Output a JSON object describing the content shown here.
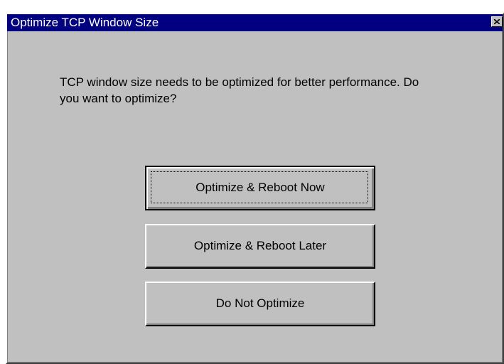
{
  "window": {
    "title": "Optimize TCP Window Size",
    "close_icon": "close-icon"
  },
  "message": "TCP window size needs to be optimized for better performance. Do you want to optimize?",
  "buttons": {
    "reboot_now": "Optimize & Reboot Now",
    "reboot_later": "Optimize & Reboot Later",
    "do_not_optimize": "Do Not Optimize"
  },
  "colors": {
    "titlebar": "#000080",
    "face": "#c0c0c0"
  }
}
